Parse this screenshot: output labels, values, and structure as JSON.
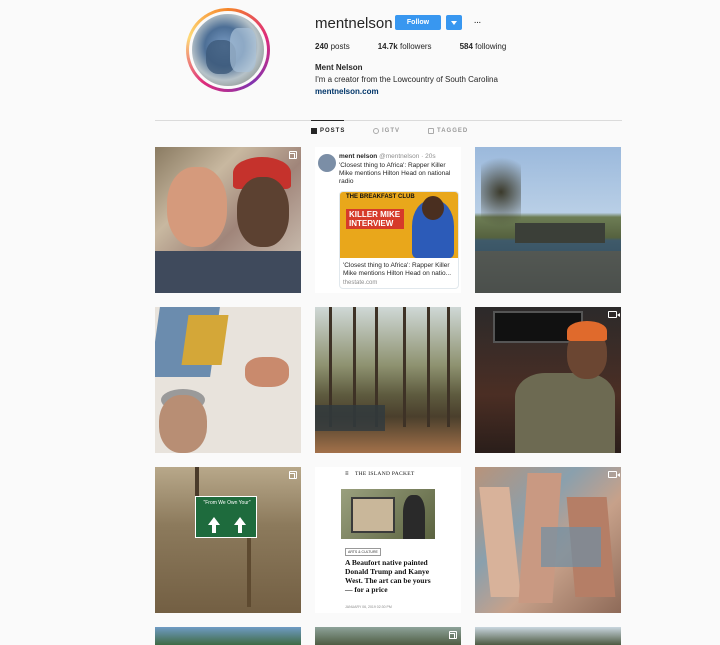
{
  "profile": {
    "username": "mentnelson",
    "follow_label": "Follow",
    "more_label": "···",
    "stats": {
      "posts_value": "240",
      "posts_label": "posts",
      "followers_value": "14.7k",
      "followers_label": "followers",
      "following_value": "584",
      "following_label": "following"
    },
    "full_name": "Ment Nelson",
    "bio": "I'm a creator from the Lowcountry of South Carolina",
    "link": "mentnelson.com"
  },
  "tabs": [
    {
      "label": "POSTS",
      "icon": "grid-icon",
      "active": true
    },
    {
      "label": "IGTV",
      "icon": "igtv-icon",
      "active": false
    },
    {
      "label": "TAGGED",
      "icon": "tag-icon",
      "active": false
    }
  ],
  "tweet_post": {
    "author": "ment nelson",
    "handle": "@mentnelson",
    "time": "· 20s",
    "text": "'Closest thing to Africa': Rapper Killer Mike mentions Hilton Head on national radio",
    "card_logo": "THE BREAKFAST CLUB",
    "card_banner": "KILLER MIKE INTERVIEW",
    "card_title": "'Closest thing to Africa': Rapper Killer Mike mentions Hilton Head on natio...",
    "card_source": "thestate.com"
  },
  "sign_post": {
    "sign_text": "\"From We Own Your\""
  },
  "news_post": {
    "masthead": "THE ISLAND PACKET",
    "tag": "ARTS & CULTURE",
    "headline": "A Beaufort native painted Donald Trump and Kanye West. The art can be yours — for a price",
    "byline": "JANUARY 06, 2019 02:30 PM"
  },
  "colors": {
    "accent": "#3897f0",
    "link": "#003569",
    "text": "#262626",
    "muted": "#8e8e8e",
    "background": "#fafafa"
  }
}
